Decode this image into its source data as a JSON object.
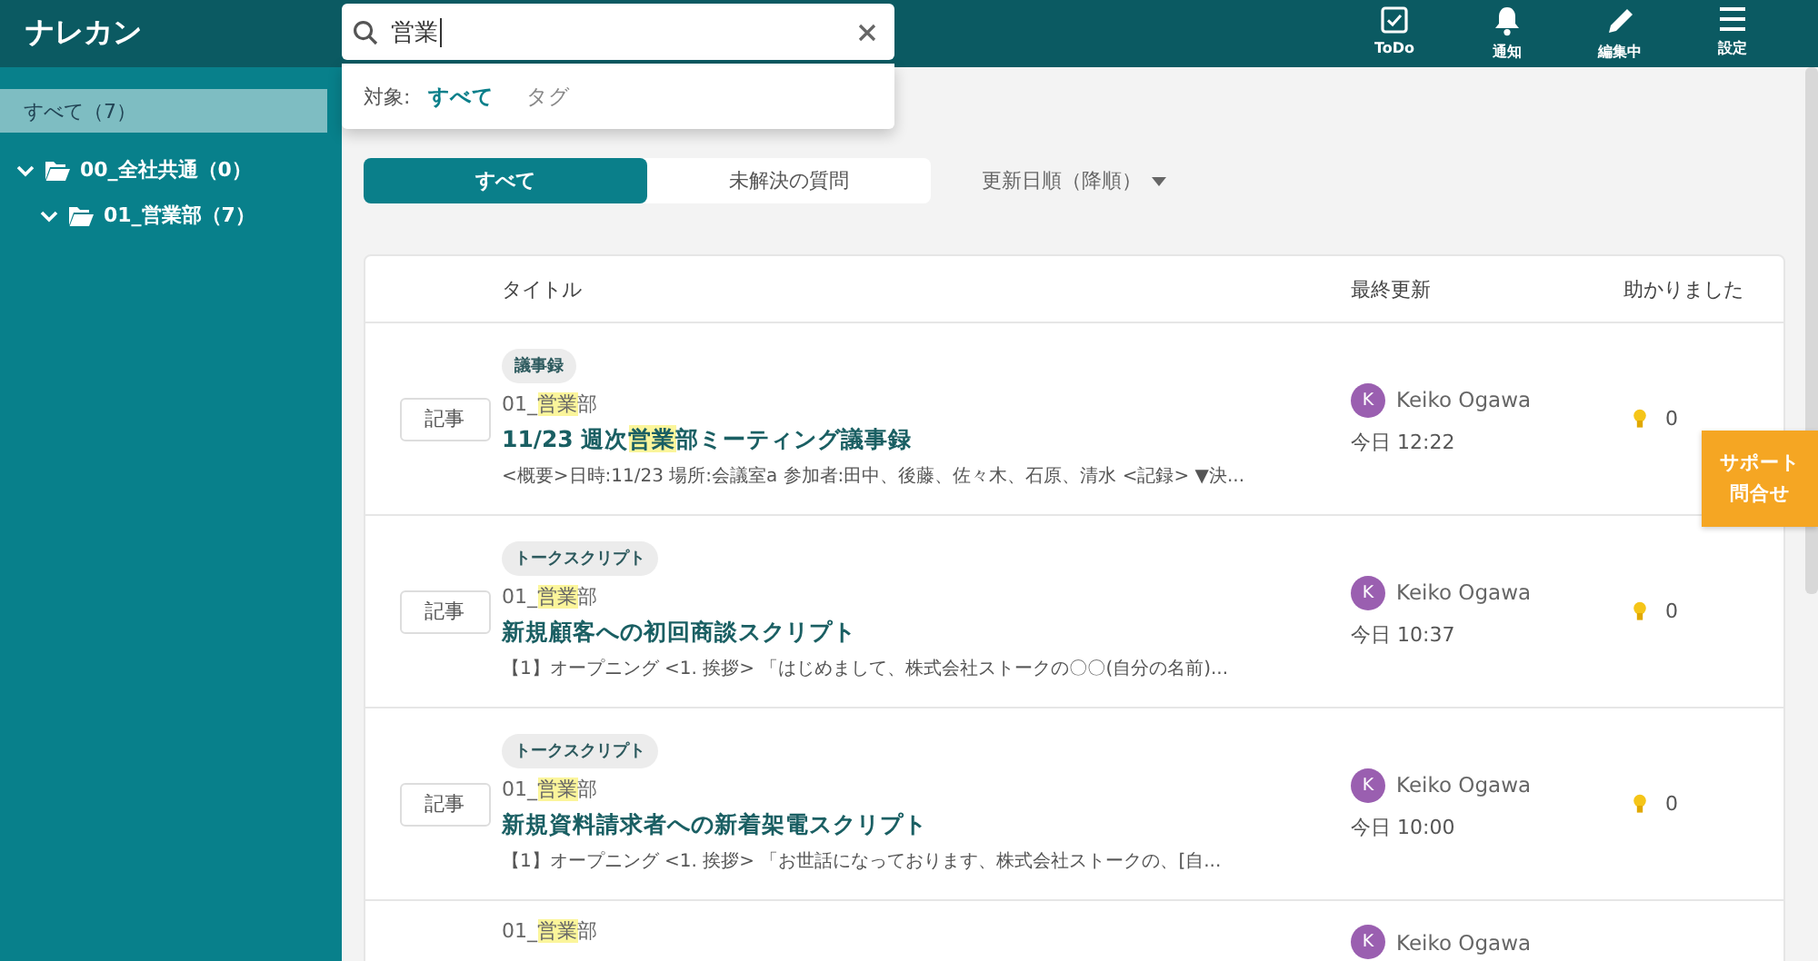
{
  "app": {
    "logo": "ナレカン"
  },
  "search": {
    "value": "営業",
    "scope_label": "対象:",
    "scopes": [
      {
        "label": "すべて",
        "selected": true
      },
      {
        "label": "タグ",
        "selected": false
      }
    ]
  },
  "toolbar": [
    {
      "kind": "todo",
      "label": "ToDo"
    },
    {
      "kind": "bell",
      "label": "通知"
    },
    {
      "kind": "pencil",
      "label": "編集中"
    },
    {
      "kind": "menu",
      "label": "設定"
    }
  ],
  "sidebar": {
    "items": [
      {
        "label": "すべて（7）",
        "selected": true
      }
    ],
    "tree": [
      {
        "label": "00_全社共通（0）",
        "expanded": true,
        "selected": false,
        "children": [
          {
            "label": "01_営業部（7）",
            "expanded": true,
            "selected": false
          }
        ]
      }
    ]
  },
  "filter_tabs": [
    {
      "label": "すべて",
      "selected": true
    },
    {
      "label": "未解決の質問",
      "selected": false
    }
  ],
  "sort": {
    "label": "更新日順（降順）"
  },
  "table": {
    "columns": [
      "タイトル",
      "最終更新",
      "助かりました"
    ],
    "rows": [
      {
        "type": "記事",
        "tag": "議事録",
        "path": [
          {
            "text": "01_",
            "hit": false
          },
          {
            "text": "営業",
            "hit": true
          },
          {
            "text": "部",
            "hit": false
          }
        ],
        "title": [
          {
            "text": "11/23 週次",
            "hit": false
          },
          {
            "text": "営業",
            "hit": true
          },
          {
            "text": "部ミーティング議事録",
            "hit": false
          }
        ],
        "excerpt": "<概要>日時:11/23 場所:会議室a 参加者:田中、後藤、佐々木、石原、清水 <記録> ▼決...",
        "author_initial": "K",
        "author": "Keiko Ogawa",
        "updated": "今日 12:22",
        "helpful": "0"
      },
      {
        "type": "記事",
        "tag": "トークスクリプト",
        "path": [
          {
            "text": "01_",
            "hit": false
          },
          {
            "text": "営業",
            "hit": true
          },
          {
            "text": "部",
            "hit": false
          }
        ],
        "title": [
          {
            "text": "新規顧客への初回商談スクリプト",
            "hit": false
          }
        ],
        "excerpt": "【1】オープニング <1. 挨拶> 「はじめまして、株式会社ストークの〇〇(自分の名前)...",
        "author_initial": "K",
        "author": "Keiko Ogawa",
        "updated": "今日 10:37",
        "helpful": "0"
      },
      {
        "type": "記事",
        "tag": "トークスクリプト",
        "path": [
          {
            "text": "01_",
            "hit": false
          },
          {
            "text": "営業",
            "hit": true
          },
          {
            "text": "部",
            "hit": false
          }
        ],
        "title": [
          {
            "text": "新規資料請求者への新着架電スクリプト",
            "hit": false
          }
        ],
        "excerpt": "【1】オープニング <1. 挨拶> 「お世話になっております、株式会社ストークの、[自...",
        "author_initial": "K",
        "author": "Keiko Ogawa",
        "updated": "今日 10:00",
        "helpful": "0"
      },
      {
        "path": [
          {
            "text": "01_",
            "hit": false
          },
          {
            "text": "営業",
            "hit": true
          },
          {
            "text": "部",
            "hit": false
          }
        ],
        "author_initial": "K",
        "author": "Keiko Ogawa"
      }
    ]
  },
  "support_button": {
    "lines": [
      "サポート",
      "問合せ"
    ]
  }
}
